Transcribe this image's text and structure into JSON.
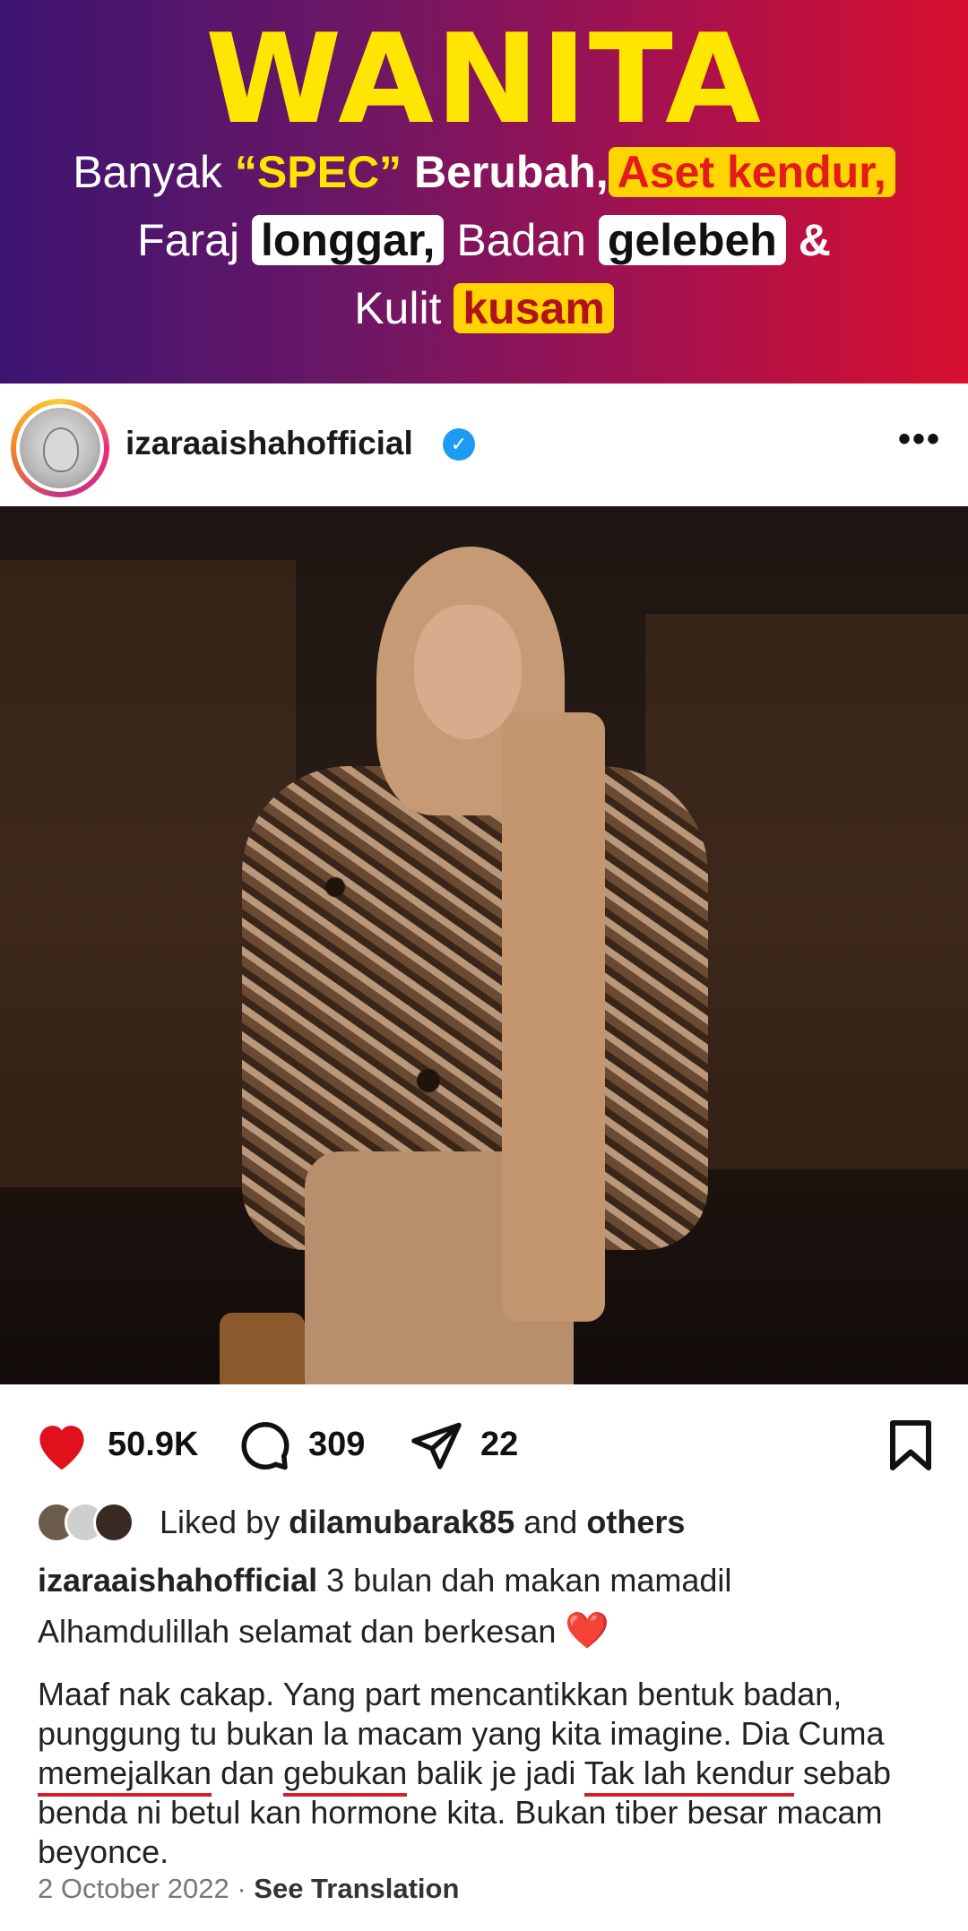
{
  "banner": {
    "title": "WANITA",
    "line1": {
      "a": "Banyak",
      "b": "“SPEC”",
      "c": "Berubah,",
      "d": "Aset kendur,"
    },
    "line2": {
      "a": "Faraj",
      "b": "longgar,",
      "c": "Badan",
      "d": "gelebeh",
      "e": "&"
    },
    "line3": {
      "a": "Kulit",
      "b": "kusam"
    }
  },
  "post": {
    "username": "izaraaishahofficial",
    "verified_icon": "verified-badge-icon",
    "more_icon": "more-options-icon",
    "actions": {
      "likes": "50.9K",
      "comments": "309",
      "shares": "22"
    },
    "liked_by": {
      "prefix": "Liked by",
      "user": "dilamubarak85",
      "and": "and",
      "others": "others"
    },
    "caption": {
      "username": "izaraaishahofficial",
      "line1": "3 bulan dah makan mamadil",
      "line2": "Alhamdulillah selamat dan berkesan",
      "heart": "❤️",
      "p2_part1": "Maaf nak cakap. Yang part mencantikkan bentuk badan, punggung tu bukan la macam yang kita imagine. Dia Cuma ",
      "p2_u1": "memejalkan",
      "p2_part2": " dan ",
      "p2_u2": "gebukan",
      "p2_part3": " balik je jadi ",
      "p2_u3": "Tak lah kendur",
      "p2_part4": " sebab benda ni betul kan hormone kita. Bukan tiber besar macam beyonce."
    },
    "date": "2 October 2022",
    "separator": "·",
    "see_translation": "See Translation",
    "colors": {
      "like_red": "#e0101c",
      "verified_blue": "#1d9bf0",
      "title_yellow": "#ffe600"
    }
  }
}
